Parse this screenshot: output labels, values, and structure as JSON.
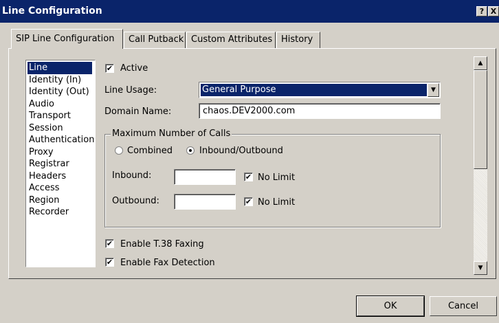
{
  "window": {
    "title": "Line Configuration",
    "help_glyph": "?",
    "close_glyph": "X"
  },
  "tabs": [
    {
      "label": "SIP Line Configuration",
      "active": true
    },
    {
      "label": "Call Putback",
      "active": false
    },
    {
      "label": "Custom Attributes",
      "active": false
    },
    {
      "label": "History",
      "active": false
    }
  ],
  "categories": [
    {
      "label": "Line",
      "selected": true
    },
    {
      "label": "Identity (In)"
    },
    {
      "label": "Identity (Out)"
    },
    {
      "label": "Audio"
    },
    {
      "label": "Transport"
    },
    {
      "label": "Session"
    },
    {
      "label": "Authentication"
    },
    {
      "label": "Proxy"
    },
    {
      "label": "Registrar"
    },
    {
      "label": "Headers"
    },
    {
      "label": "Access"
    },
    {
      "label": "Region"
    },
    {
      "label": "Recorder"
    }
  ],
  "form": {
    "active_label": "Active",
    "active_checked": true,
    "line_usage_label": "Line Usage:",
    "line_usage_value": "General Purpose",
    "domain_name_label": "Domain Name:",
    "domain_name_value": "chaos.DEV2000.com",
    "max_calls": {
      "legend": "Maximum Number of Calls",
      "combined_label": "Combined",
      "inbound_outbound_label": "Inbound/Outbound",
      "selected": "Inbound/Outbound",
      "inbound_label": "Inbound:",
      "inbound_value": "",
      "outbound_label": "Outbound:",
      "outbound_value": "",
      "no_limit_label": "No Limit",
      "inbound_no_limit": true,
      "outbound_no_limit": true
    },
    "t38_label": "Enable T.38 Faxing",
    "t38_checked": true,
    "fax_detect_label": "Enable Fax Detection",
    "fax_detect_checked": true
  },
  "buttons": {
    "ok": "OK",
    "cancel": "Cancel"
  },
  "icons": {
    "check": "✔",
    "up_arrow": "▲",
    "down_arrow": "▼"
  },
  "colors": {
    "titlebar": "#0a246a",
    "face": "#d4d0c8",
    "selection": "#0a246a"
  }
}
